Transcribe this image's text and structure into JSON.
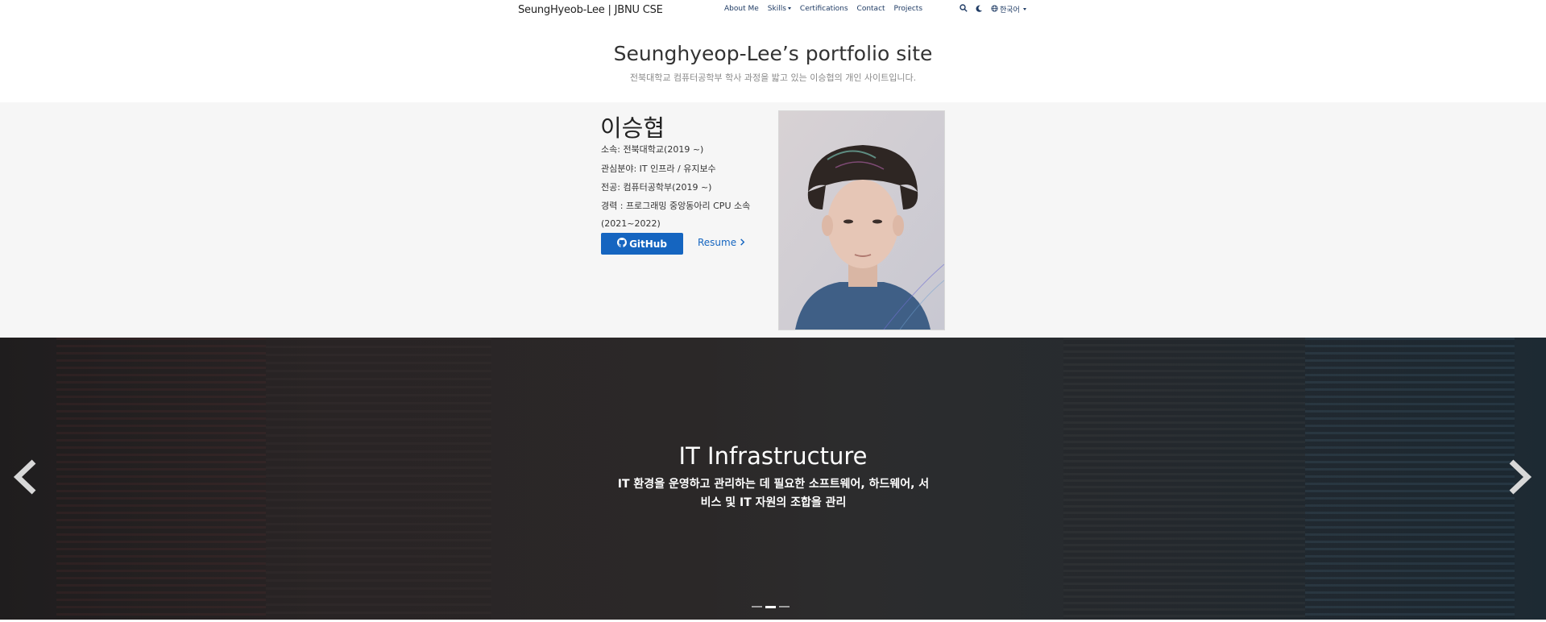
{
  "navbar": {
    "brand": "SeungHyeob-Lee | JBNU CSE",
    "links": [
      "About Me",
      "Skills",
      "Certifications",
      "Contact",
      "Projects"
    ],
    "language": "한국어"
  },
  "header": {
    "title": "Seunghyeop-Lee’s portfolio site",
    "subtitle": "전북대학교 컴퓨터공학부 학사 과정을 밟고 있는 이승협의 개인 사이트입니다."
  },
  "profile": {
    "name": "이승협",
    "lines": [
      "소속: 전북대학교(2019 ~)",
      "관심분야: IT 인프라 / 유지보수",
      "전공: 컴퓨터공학부(2019 ~)",
      "경력 : 프로그래밍 중앙동아리 CPU 소속",
      "(2021~2022)"
    ],
    "github_label": "GitHub",
    "resume_label": "Resume"
  },
  "carousel": {
    "title": "IT Infrastructure",
    "description": "IT 환경을 운영하고 관리하는 데 필요한 소프트웨어, 하드웨어, 서비스 및 IT 자원의 조합을 관리",
    "indicator_count": 3,
    "active_index": 1
  },
  "icons": {
    "search": "search-icon",
    "theme": "moon-icon",
    "language": "globe-icon",
    "github": "github-icon",
    "prev": "chevron-left-icon",
    "next": "chevron-right-icon"
  }
}
